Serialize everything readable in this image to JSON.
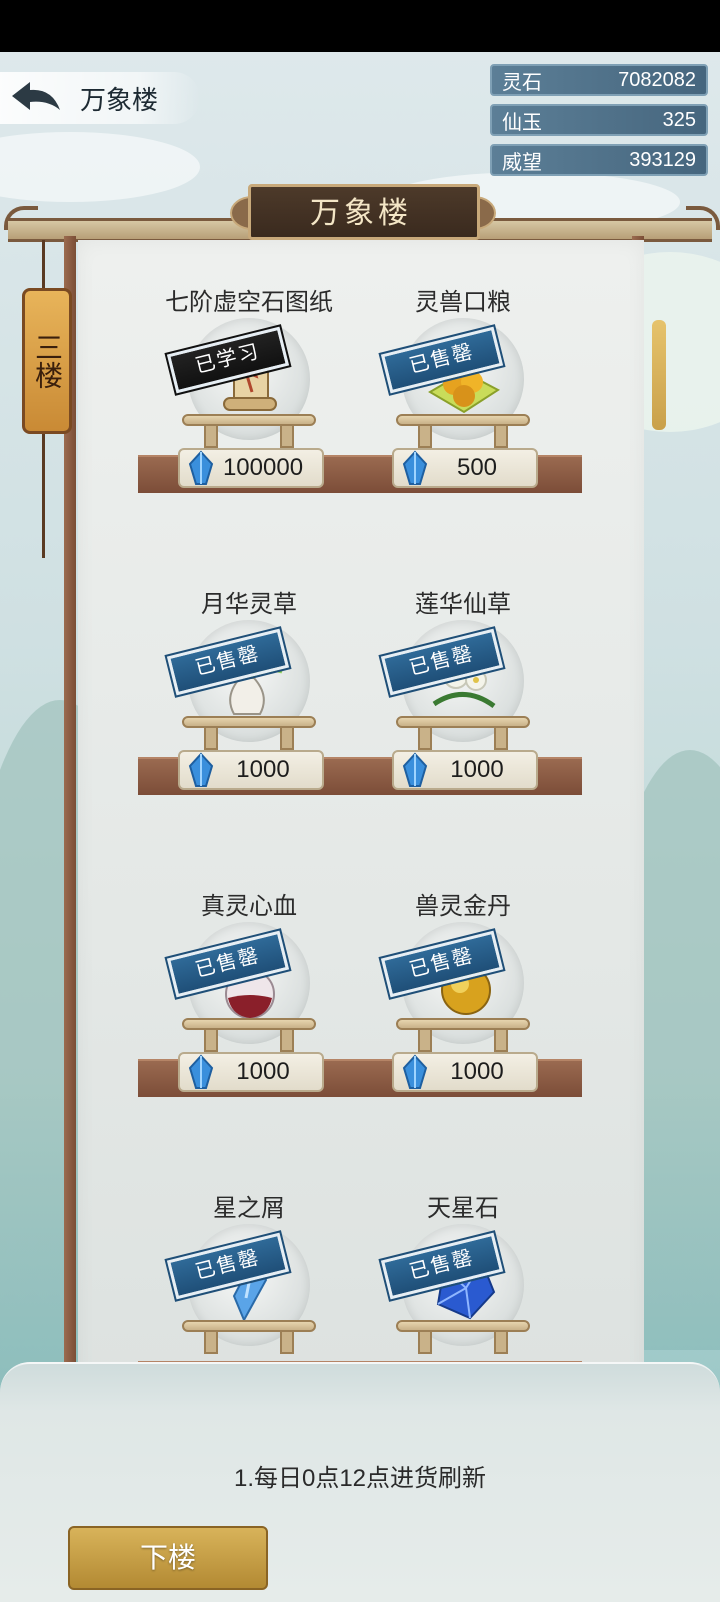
{
  "header": {
    "title": "万象楼"
  },
  "resources": [
    {
      "label": "灵石",
      "value": "7082082"
    },
    {
      "label": "仙玉",
      "value": "325"
    },
    {
      "label": "威望",
      "value": "393129"
    }
  ],
  "sign": {
    "title": "万象楼"
  },
  "floor_tag": "三楼",
  "items": [
    {
      "name": "七阶虚空石图纸",
      "price": "100000",
      "stamp": "已学习",
      "art": "scroll"
    },
    {
      "name": "灵兽口粮",
      "price": "500",
      "stamp": "已售罄",
      "art": "orange-pills"
    },
    {
      "name": "月华灵草",
      "price": "1000",
      "stamp": "已售罄",
      "art": "vase-herb"
    },
    {
      "name": "莲华仙草",
      "price": "1000",
      "stamp": "已售罄",
      "art": "lotus"
    },
    {
      "name": "真灵心血",
      "price": "1000",
      "stamp": "已售罄",
      "art": "potion"
    },
    {
      "name": "兽灵金丹",
      "price": "1000",
      "stamp": "已售罄",
      "art": "gold-pill"
    },
    {
      "name": "星之屑",
      "price": "",
      "stamp": "已售罄",
      "art": "crystal-shard"
    },
    {
      "name": "天星石",
      "price": "",
      "stamp": "已售罄",
      "art": "blue-gem"
    }
  ],
  "notice": "1.每日0点12点进货刷新",
  "buttons": {
    "down_label": "下楼"
  },
  "colors": {
    "stamp_blue": "#1f4f78",
    "gold_button": "#c9a04a"
  }
}
